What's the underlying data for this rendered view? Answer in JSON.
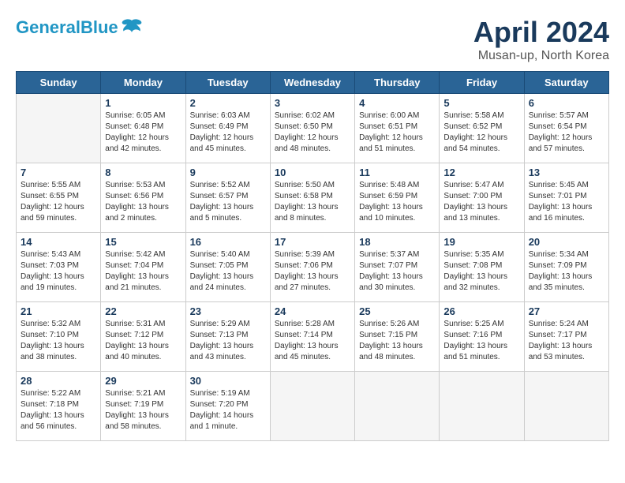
{
  "header": {
    "logo_line1": "General",
    "logo_line2": "Blue",
    "month": "April 2024",
    "location": "Musan-up, North Korea"
  },
  "days_of_week": [
    "Sunday",
    "Monday",
    "Tuesday",
    "Wednesday",
    "Thursday",
    "Friday",
    "Saturday"
  ],
  "weeks": [
    [
      {
        "day": "",
        "info": ""
      },
      {
        "day": "1",
        "info": "Sunrise: 6:05 AM\nSunset: 6:48 PM\nDaylight: 12 hours\nand 42 minutes."
      },
      {
        "day": "2",
        "info": "Sunrise: 6:03 AM\nSunset: 6:49 PM\nDaylight: 12 hours\nand 45 minutes."
      },
      {
        "day": "3",
        "info": "Sunrise: 6:02 AM\nSunset: 6:50 PM\nDaylight: 12 hours\nand 48 minutes."
      },
      {
        "day": "4",
        "info": "Sunrise: 6:00 AM\nSunset: 6:51 PM\nDaylight: 12 hours\nand 51 minutes."
      },
      {
        "day": "5",
        "info": "Sunrise: 5:58 AM\nSunset: 6:52 PM\nDaylight: 12 hours\nand 54 minutes."
      },
      {
        "day": "6",
        "info": "Sunrise: 5:57 AM\nSunset: 6:54 PM\nDaylight: 12 hours\nand 57 minutes."
      }
    ],
    [
      {
        "day": "7",
        "info": "Sunrise: 5:55 AM\nSunset: 6:55 PM\nDaylight: 12 hours\nand 59 minutes."
      },
      {
        "day": "8",
        "info": "Sunrise: 5:53 AM\nSunset: 6:56 PM\nDaylight: 13 hours\nand 2 minutes."
      },
      {
        "day": "9",
        "info": "Sunrise: 5:52 AM\nSunset: 6:57 PM\nDaylight: 13 hours\nand 5 minutes."
      },
      {
        "day": "10",
        "info": "Sunrise: 5:50 AM\nSunset: 6:58 PM\nDaylight: 13 hours\nand 8 minutes."
      },
      {
        "day": "11",
        "info": "Sunrise: 5:48 AM\nSunset: 6:59 PM\nDaylight: 13 hours\nand 10 minutes."
      },
      {
        "day": "12",
        "info": "Sunrise: 5:47 AM\nSunset: 7:00 PM\nDaylight: 13 hours\nand 13 minutes."
      },
      {
        "day": "13",
        "info": "Sunrise: 5:45 AM\nSunset: 7:01 PM\nDaylight: 13 hours\nand 16 minutes."
      }
    ],
    [
      {
        "day": "14",
        "info": "Sunrise: 5:43 AM\nSunset: 7:03 PM\nDaylight: 13 hours\nand 19 minutes."
      },
      {
        "day": "15",
        "info": "Sunrise: 5:42 AM\nSunset: 7:04 PM\nDaylight: 13 hours\nand 21 minutes."
      },
      {
        "day": "16",
        "info": "Sunrise: 5:40 AM\nSunset: 7:05 PM\nDaylight: 13 hours\nand 24 minutes."
      },
      {
        "day": "17",
        "info": "Sunrise: 5:39 AM\nSunset: 7:06 PM\nDaylight: 13 hours\nand 27 minutes."
      },
      {
        "day": "18",
        "info": "Sunrise: 5:37 AM\nSunset: 7:07 PM\nDaylight: 13 hours\nand 30 minutes."
      },
      {
        "day": "19",
        "info": "Sunrise: 5:35 AM\nSunset: 7:08 PM\nDaylight: 13 hours\nand 32 minutes."
      },
      {
        "day": "20",
        "info": "Sunrise: 5:34 AM\nSunset: 7:09 PM\nDaylight: 13 hours\nand 35 minutes."
      }
    ],
    [
      {
        "day": "21",
        "info": "Sunrise: 5:32 AM\nSunset: 7:10 PM\nDaylight: 13 hours\nand 38 minutes."
      },
      {
        "day": "22",
        "info": "Sunrise: 5:31 AM\nSunset: 7:12 PM\nDaylight: 13 hours\nand 40 minutes."
      },
      {
        "day": "23",
        "info": "Sunrise: 5:29 AM\nSunset: 7:13 PM\nDaylight: 13 hours\nand 43 minutes."
      },
      {
        "day": "24",
        "info": "Sunrise: 5:28 AM\nSunset: 7:14 PM\nDaylight: 13 hours\nand 45 minutes."
      },
      {
        "day": "25",
        "info": "Sunrise: 5:26 AM\nSunset: 7:15 PM\nDaylight: 13 hours\nand 48 minutes."
      },
      {
        "day": "26",
        "info": "Sunrise: 5:25 AM\nSunset: 7:16 PM\nDaylight: 13 hours\nand 51 minutes."
      },
      {
        "day": "27",
        "info": "Sunrise: 5:24 AM\nSunset: 7:17 PM\nDaylight: 13 hours\nand 53 minutes."
      }
    ],
    [
      {
        "day": "28",
        "info": "Sunrise: 5:22 AM\nSunset: 7:18 PM\nDaylight: 13 hours\nand 56 minutes."
      },
      {
        "day": "29",
        "info": "Sunrise: 5:21 AM\nSunset: 7:19 PM\nDaylight: 13 hours\nand 58 minutes."
      },
      {
        "day": "30",
        "info": "Sunrise: 5:19 AM\nSunset: 7:20 PM\nDaylight: 14 hours\nand 1 minute."
      },
      {
        "day": "",
        "info": ""
      },
      {
        "day": "",
        "info": ""
      },
      {
        "day": "",
        "info": ""
      },
      {
        "day": "",
        "info": ""
      }
    ]
  ]
}
